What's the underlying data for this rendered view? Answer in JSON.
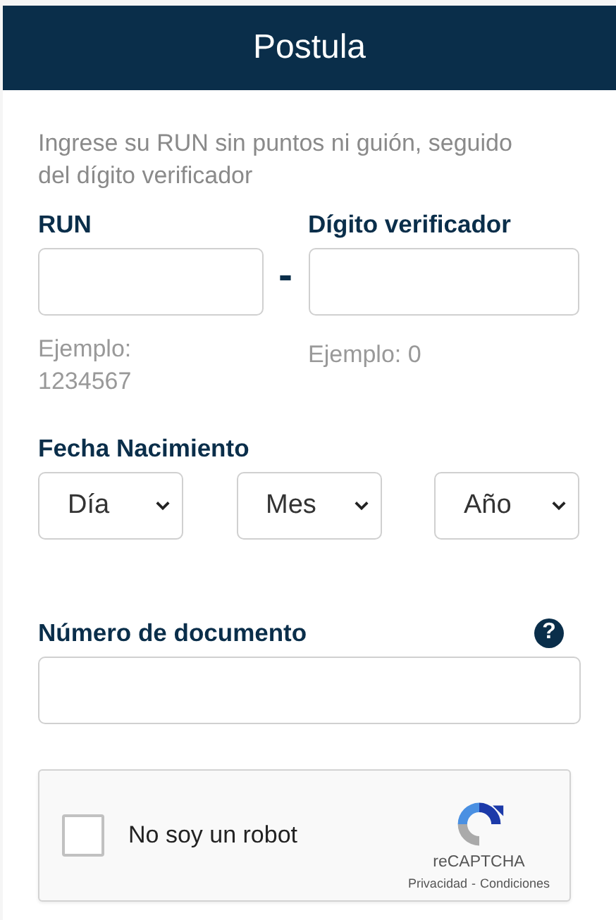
{
  "header": {
    "title": "Postula"
  },
  "hint": "Ingrese su RUN sin puntos ni guión, seguido del dígito verificador",
  "run": {
    "label": "RUN",
    "separator": "-",
    "example": "Ejemplo: 1234567"
  },
  "check_digit": {
    "label": "Dígito verificador",
    "example": "Ejemplo: 0"
  },
  "birth_date": {
    "label": "Fecha Nacimiento",
    "selects": [
      {
        "placeholder": "Día"
      },
      {
        "placeholder": "Mes"
      },
      {
        "placeholder": "Año"
      }
    ]
  },
  "document_number": {
    "label": "Número de documento",
    "help": "?"
  },
  "captcha": {
    "label": "No soy un robot",
    "checked": false,
    "brand": "reCAPTCHA",
    "links": [
      "Privacidad",
      "Condiciones"
    ],
    "link_separator": "-"
  }
}
